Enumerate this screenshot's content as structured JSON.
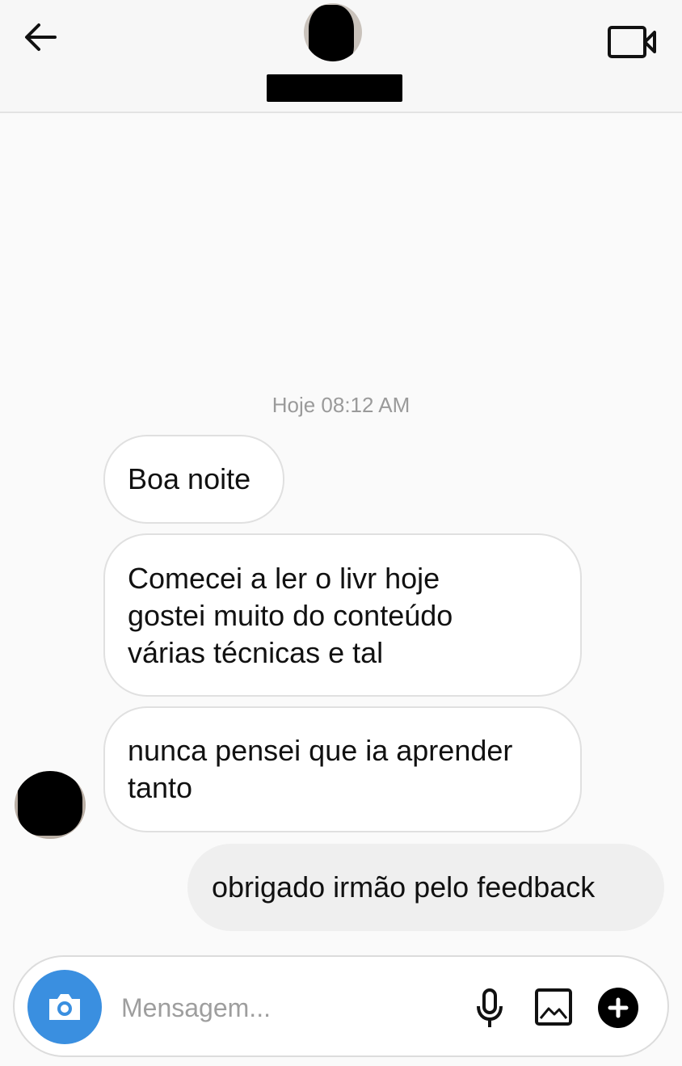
{
  "header": {
    "contact_name": "redacted",
    "back_icon": "arrow-left-icon",
    "video_icon": "video-camera-icon"
  },
  "conversation": {
    "timestamp": "Hoje 08:12 AM",
    "incoming": [
      {
        "text": "Boa noite"
      },
      {
        "text": "Comecei a ler o livr hoje\ngostei muito do conteúdo\nvárias técnicas e tal"
      },
      {
        "text": "nunca pensei que ia aprender\ntanto"
      }
    ],
    "outgoing": [
      {
        "text": "obrigado irmão pelo feedback"
      }
    ]
  },
  "composer": {
    "placeholder": "Mensagem...",
    "value": "",
    "camera_icon": "camera-icon",
    "mic_icon": "microphone-icon",
    "gallery_icon": "image-gallery-icon",
    "plus_icon": "plus-icon",
    "accent_color": "#3a8fe0"
  }
}
